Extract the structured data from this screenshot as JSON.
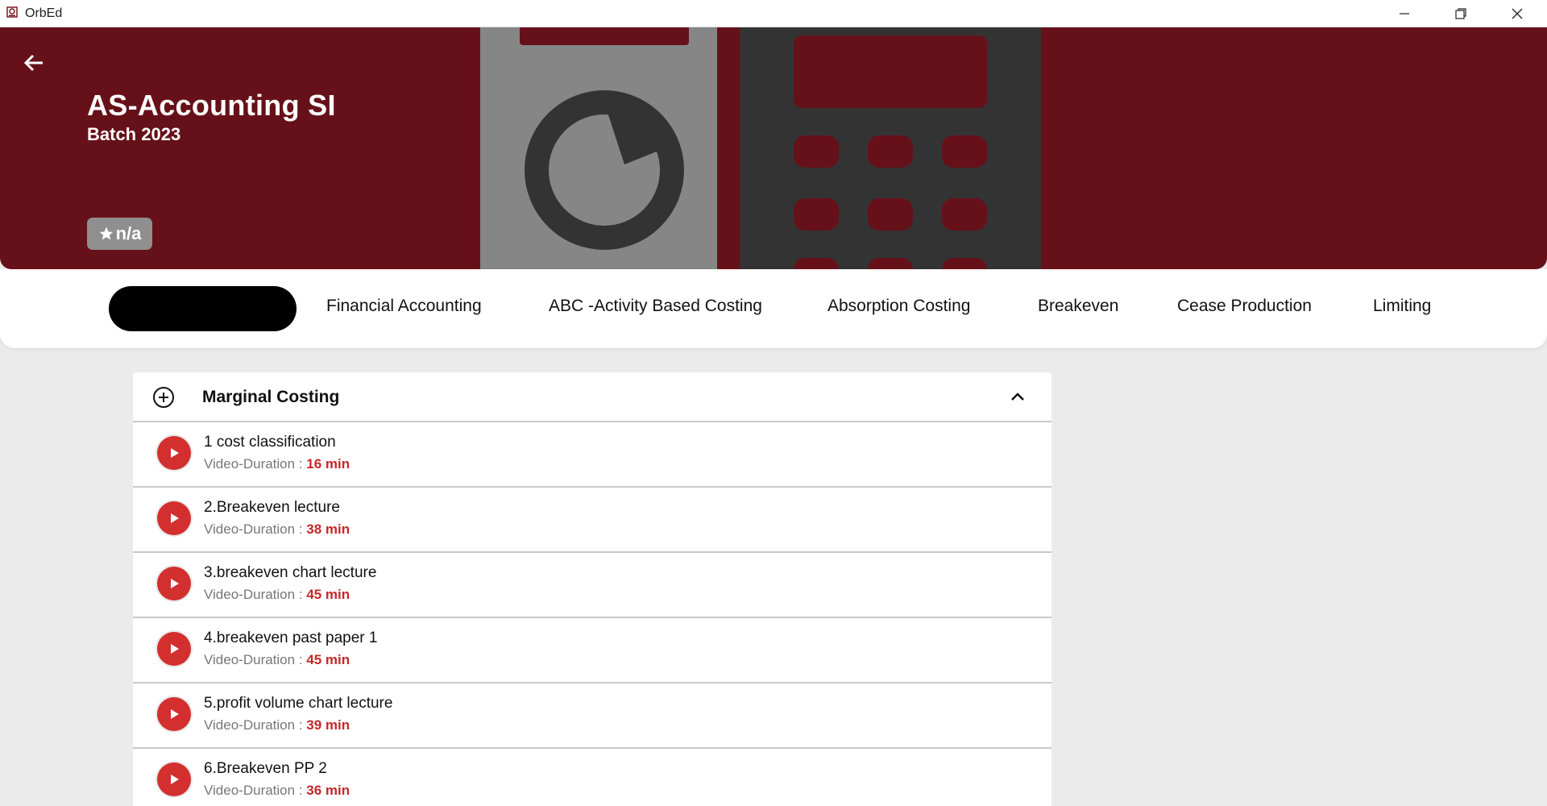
{
  "window": {
    "title": "OrbEd",
    "controls": [
      "minimize",
      "restore",
      "close"
    ]
  },
  "hero": {
    "title": "AS-Accounting SI",
    "subtitle": "Batch 2023",
    "rating": "n/a"
  },
  "tabs": {
    "active_label": "",
    "items": [
      {
        "label": "Financial Accounting"
      },
      {
        "label": "ABC -Activity Based Costing"
      },
      {
        "label": "Absorption Costing"
      },
      {
        "label": "Breakeven"
      },
      {
        "label": "Cease Production"
      },
      {
        "label": "Limiting"
      }
    ]
  },
  "section": {
    "title": "Marginal Costing",
    "expanded": true,
    "duration_prefix": "Video-Duration : ",
    "lectures": [
      {
        "title": "1 cost classification",
        "duration": "16 min"
      },
      {
        "title": "2.Breakeven lecture",
        "duration": "38 min"
      },
      {
        "title": "3.breakeven chart lecture",
        "duration": "45 min"
      },
      {
        "title": "4.breakeven past paper 1",
        "duration": "45 min"
      },
      {
        "title": "5.profit volume chart lecture",
        "duration": "39 min"
      },
      {
        "title": "6.Breakeven PP 2",
        "duration": "36 min"
      }
    ]
  },
  "colors": {
    "hero_bg": "#661119",
    "accent_red": "#d32f2f",
    "duration_red": "#c62828",
    "active_tab": "#000000",
    "page_bg": "#ebebeb"
  }
}
